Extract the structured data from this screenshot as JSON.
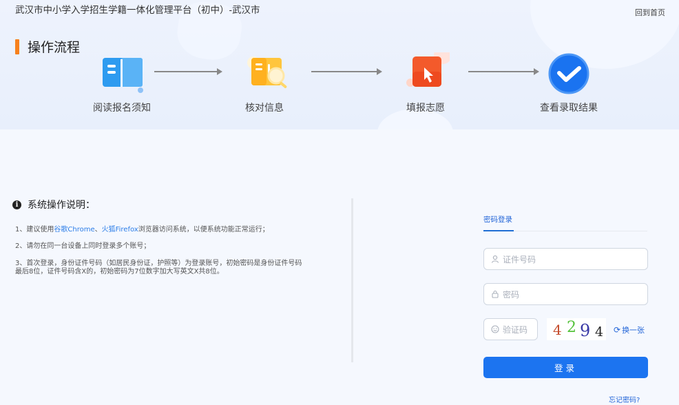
{
  "header": {
    "title": "武汉市中小学入学招生学籍一体化管理平台（初中）-武汉市",
    "home_link": "回到首页"
  },
  "flow": {
    "title": "操作流程",
    "steps": [
      {
        "label": "阅读报名须知",
        "icon": "book-icon"
      },
      {
        "label": "核对信息",
        "icon": "document-search-icon"
      },
      {
        "label": "填报志愿",
        "icon": "cursor-click-icon"
      },
      {
        "label": "查看录取结果",
        "icon": "check-circle-icon"
      }
    ],
    "colors": {
      "accent": "#f7811d",
      "step1": "#2e9bf0",
      "step2": "#ffb829",
      "step3": "#f35a2b",
      "step4": "#1a73f0"
    }
  },
  "instructions": {
    "title": "系统操作说明：",
    "item1_prefix": "1、建议使用",
    "item1_link1": "谷歌Chrome",
    "item1_sep": "、",
    "item1_link2": "火狐Firefox",
    "item1_suffix": "浏览器访问系统，以便系统功能正常运行；",
    "item2": "2、请勿在同一台设备上同时登录多个账号；",
    "item3": "3、首次登录，身份证件号码（如居民身份证，护照等）为登录账号，初始密码是身份证件号码最后8位，证件号码含X的，初始密码为7位数字加大写英文X共8位。"
  },
  "login": {
    "tab_label": "密码登录",
    "id_placeholder": "证件号码",
    "password_placeholder": "密码",
    "captcha_placeholder": "验证码",
    "captcha_chars": [
      "4",
      "2",
      "9",
      "4"
    ],
    "refresh_label": "换一张",
    "submit_label": "登录",
    "forgot_label": "忘记密码?"
  }
}
